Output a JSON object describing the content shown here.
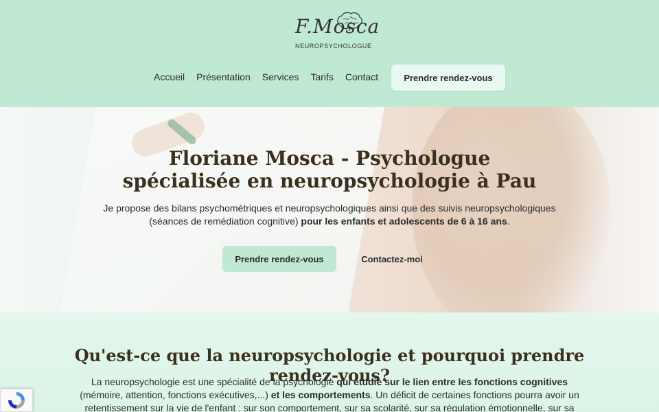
{
  "logo": {
    "script_text": "F.Mosca",
    "subtitle": "NEUROPSYCHOLOGUE"
  },
  "nav": {
    "items": [
      {
        "label": "Accueil"
      },
      {
        "label": "Présentation"
      },
      {
        "label": "Services"
      },
      {
        "label": "Tarifs"
      },
      {
        "label": "Contact"
      }
    ],
    "cta_label": "Prendre rendez-vous"
  },
  "hero": {
    "title_line1": "Floriane Mosca - Psychologue",
    "title_line2": "spécialisée en neuropsychologie à Pau",
    "text_plain_1": "Je propose des bilans psychométriques et neuropsychologiques ainsi que des suivis neuropsychologiques (séances de remédiation cognitive) ",
    "text_bold_1": "pour les enfants et adolescents de 6 à 16 ans",
    "text_plain_2": ".",
    "primary_button": "Prendre rendez-vous",
    "secondary_button": "Contactez-moi"
  },
  "section": {
    "title": "Qu'est-ce que la neuropsychologie et pourquoi prendre rendez-vous?",
    "p1": "La neuropsychologie est une spécialité de la psychologie ",
    "b1": "qui étudie sur le lien entre les fonctions cognitives",
    "p2": " (mémoire, attention, fonctions exécutives,...) ",
    "b2": "et les comportements",
    "p3": ". Un déficit de certaines fonctions pourra avoir un retentissement sur la vie de l'enfant : sur son comportement, sur sa scolarité, sur sa régulation émotionnelle, sur sa relation aux autres..."
  },
  "colors": {
    "header_bg": "#bfe9d3",
    "accent": "#bfe9d3",
    "title": "#3b2f1e"
  }
}
